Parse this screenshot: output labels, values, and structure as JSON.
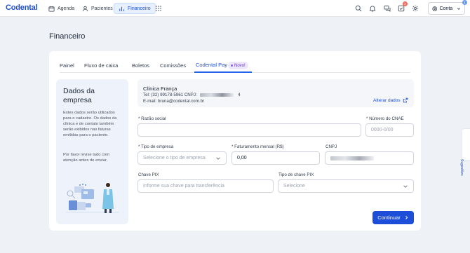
{
  "app": {
    "logo": "Codental"
  },
  "nav": {
    "agenda": "Agenda",
    "pacientes": "Pacientes",
    "financeiro": "Financeiro"
  },
  "topbar": {
    "tasks_badge": "2",
    "account_badge": "1",
    "account_label": "Conta"
  },
  "page": {
    "title": "Financeiro"
  },
  "tabs": {
    "painel": "Painel",
    "fluxo": "Fluxo de caixa",
    "boletos": "Boletos",
    "comissoes": "Comissões",
    "pay": "Codental Pay",
    "new_badge": "Novo!"
  },
  "left_panel": {
    "title_line1": "Dados da",
    "title_line2": "empresa",
    "desc": "Estes dados serão utilizados para o cadastro. Os dados da clínica e de contato também serão exibidos nas faturas emitidas para o paciente.",
    "note": "Por favor revise tudo com atenção antes de enviar."
  },
  "company": {
    "name": "Clínica França",
    "tel_label": "Tel: (32) 99178-5961   CNPJ:",
    "cnpj_end": "4",
    "email": "E-mail: bruna@codental.com.br",
    "edit_label": "Alterar dados"
  },
  "form": {
    "razao_label": "* Razão social",
    "razao_value": "",
    "cnae_label": "* Número do CNAE",
    "cnae_placeholder": "0000-0/00",
    "tipo_label": "* Tipo de empresa",
    "tipo_placeholder": "Selecione o tipo de empresa",
    "faturamento_label": "* Faturamento mensal (R$)",
    "faturamento_value": "0,00",
    "cnpj_label": "CNPJ",
    "pix_label": "Chave PIX",
    "pix_placeholder": "Informe sua chave para transferência",
    "tipo_pix_label": "Tipo de chave PIX",
    "tipo_pix_placeholder": "Selecione"
  },
  "actions": {
    "continue_label": "Continuar"
  },
  "side": {
    "suggestions_label": "Sugestões"
  }
}
